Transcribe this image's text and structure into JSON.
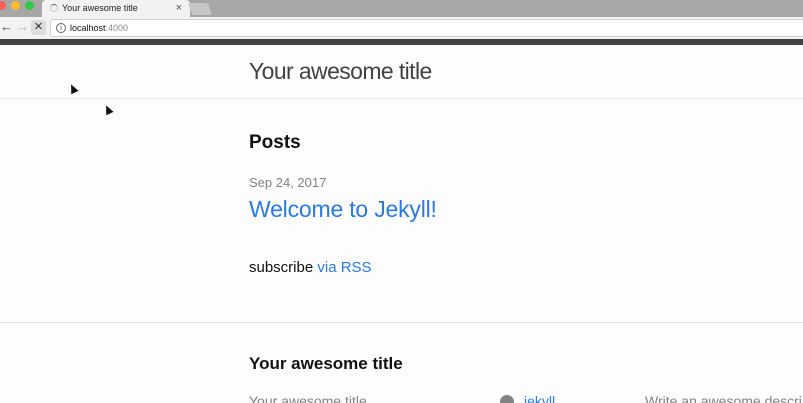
{
  "browser": {
    "tab_title": "Your awesome title",
    "tab_close": "×",
    "back": "←",
    "forward": "→",
    "stop": "✕",
    "info": "i",
    "url_host": "localhost",
    "url_port": ":4000"
  },
  "site": {
    "title": "Your awesome title"
  },
  "main": {
    "posts_heading": "Posts",
    "posts": [
      {
        "date": "Sep 24, 2017",
        "title": "Welcome to Jekyll!"
      }
    ],
    "rss_prefix": "subscribe ",
    "rss_link": "via RSS"
  },
  "footer": {
    "title": "Your awesome title",
    "col1": "Your awesome title",
    "github": "jekyll",
    "description": "Write an awesome descri"
  },
  "colors": {
    "link": "#2a7ae2",
    "meta": "#828282",
    "topbar": "#424242"
  }
}
